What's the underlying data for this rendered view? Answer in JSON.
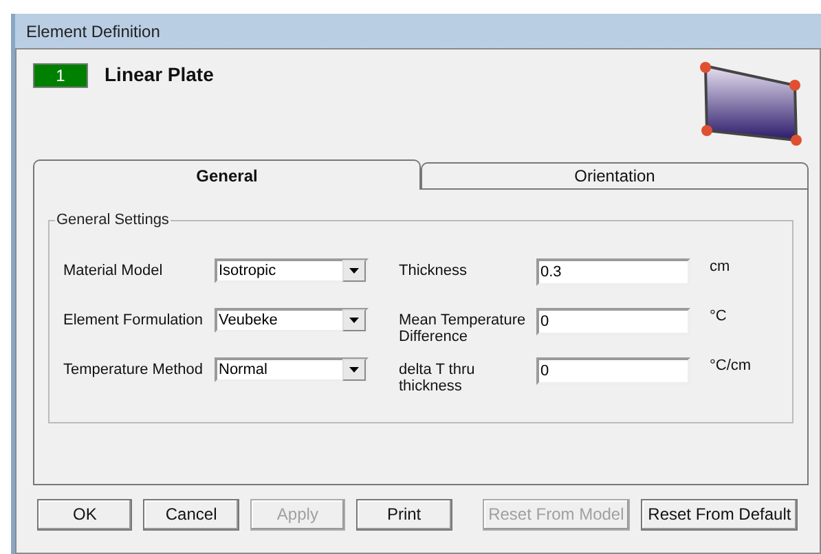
{
  "window": {
    "title": "Element Definition"
  },
  "element": {
    "number": "1",
    "name": "Linear Plate"
  },
  "tabs": [
    {
      "label": "General",
      "selected": true
    },
    {
      "label": "Orientation",
      "selected": false
    }
  ],
  "group": {
    "title": "General Settings"
  },
  "left_fields": [
    {
      "label": "Material Model",
      "value": "Isotropic"
    },
    {
      "label": "Element Formulation",
      "value": "Veubeke"
    },
    {
      "label": "Temperature Method",
      "value": "Normal"
    }
  ],
  "right_fields": [
    {
      "label": "Thickness",
      "value": "0.3",
      "unit": "cm"
    },
    {
      "label": "Mean Temperature Difference",
      "value": "0",
      "unit": "°C"
    },
    {
      "label": "delta T thru thickness",
      "value": "0",
      "unit": "°C/cm"
    }
  ],
  "buttons": [
    {
      "label": "OK",
      "disabled": false
    },
    {
      "label": "Cancel",
      "disabled": false
    },
    {
      "label": "Apply",
      "disabled": true
    },
    {
      "label": "Print",
      "disabled": false
    },
    {
      "label": "Reset From Model",
      "disabled": true
    },
    {
      "label": "Reset From Default",
      "disabled": false
    }
  ]
}
